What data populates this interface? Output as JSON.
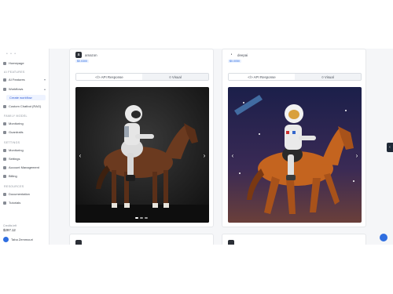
{
  "sidebar": {
    "items": [
      {
        "label": "Homepage"
      },
      {
        "label": "AI Features"
      },
      {
        "label": "Workflows"
      },
      {
        "label": "Custom Chatbot (RAG)"
      },
      {
        "label": "Monitoring"
      },
      {
        "label": "Guardrails"
      },
      {
        "label": "Monitoring"
      },
      {
        "label": "Settings"
      },
      {
        "label": "Account Management"
      },
      {
        "label": "Billing"
      },
      {
        "label": "Documentation"
      },
      {
        "label": "Tutorials"
      }
    ],
    "sub_item": "Create workflow",
    "groups": [
      "AI FEATURES",
      "FAMILY MODEL",
      "SETTINGS",
      "RESOURCES"
    ],
    "credits_label": "Credits left",
    "credits_value": "$297.12",
    "user_name": "Taha Zemmouri"
  },
  "cards": [
    {
      "provider": "amazon",
      "cost": "$0.0300",
      "tab_api": "</> API Response",
      "tab_visual": "¤ Visual"
    },
    {
      "provider": "deepai",
      "cost": "$0.0050",
      "tab_api": "</> API Response",
      "tab_visual": "¤ Visual"
    }
  ],
  "colors": {
    "accent": "#2f6ee0",
    "active_bg": "#eef3ff"
  }
}
